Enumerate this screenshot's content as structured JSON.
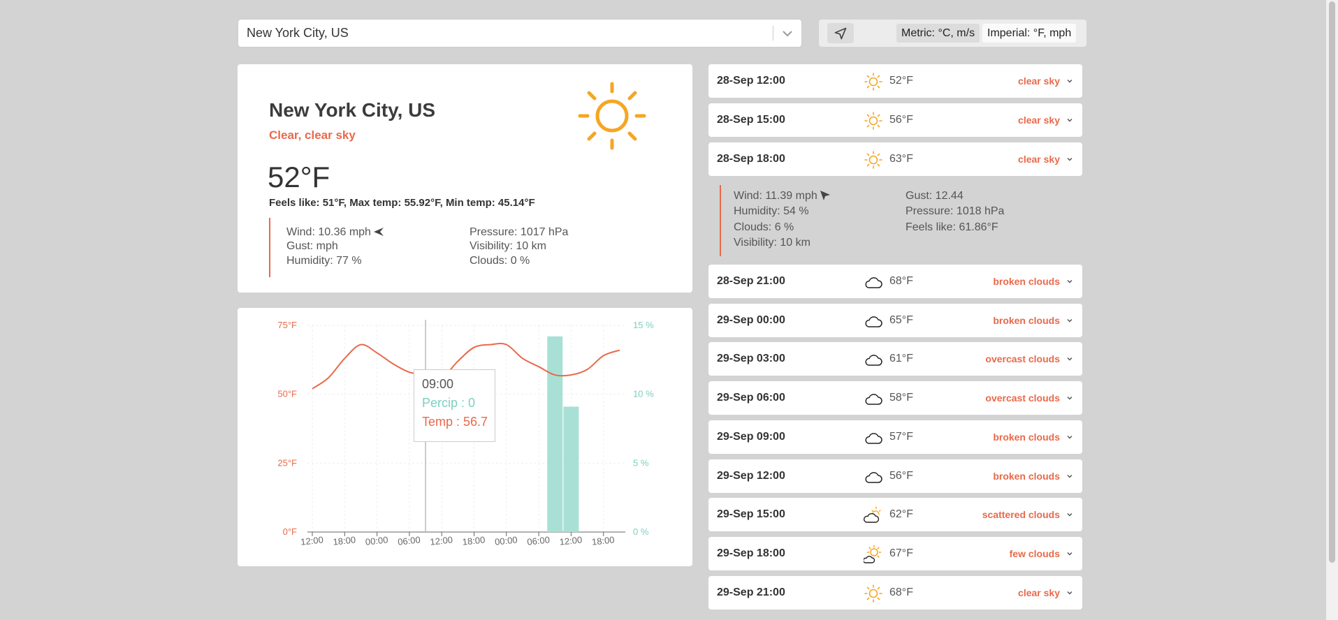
{
  "search": {
    "value": "New York City, US"
  },
  "units": {
    "metric_label": "Metric: °C, m/s",
    "imperial_label": "Imperial: °F, mph",
    "location_icon": "location-arrow-icon"
  },
  "current": {
    "city": "New York City, US",
    "description": "Clear, clear sky",
    "temp": "52°F",
    "feels": "Feels like: 51°F, Max temp: 55.92°F, Min temp: 45.14°F",
    "icon": "sun-icon",
    "wind": "Wind: 10.36 mph",
    "gust": "Gust: mph",
    "humidity": "Humidity: 77 %",
    "pressure": "Pressure: 1017 hPa",
    "visibility": "Visibility: 10 km",
    "clouds": "Clouds: 0 %"
  },
  "chart_data": {
    "type": "line",
    "categories": [
      "12:00",
      "18:00",
      "00:00",
      "06:00",
      "12:00",
      "18:00",
      "00:00",
      "06:00",
      "12:00",
      "18:00"
    ],
    "series": [
      {
        "name": "Temp",
        "axis": "left",
        "color": "#e9694a",
        "x": [
          0,
          0.5,
          1,
          1.5,
          2,
          2.5,
          3,
          3.5,
          4,
          4.5,
          5,
          5.5,
          6,
          6.5,
          7,
          7.5,
          8,
          8.5,
          9,
          9.5
        ],
        "values": [
          52,
          56,
          63,
          68,
          65,
          61,
          58,
          57,
          56,
          62,
          67,
          68,
          68,
          63,
          60,
          57,
          57,
          59,
          64,
          66
        ]
      },
      {
        "name": "Percip",
        "axis": "right",
        "color": "#a8e0d6",
        "x": [
          7.5,
          8
        ],
        "values": [
          14.2,
          9.1
        ]
      }
    ],
    "y_left": {
      "ticks": [
        "0°F",
        "25°F",
        "50°F",
        "75°F"
      ],
      "range": [
        0,
        75
      ]
    },
    "y_right": {
      "ticks": [
        "0 %",
        "5 %",
        "10 %",
        "15 %"
      ],
      "range": [
        0,
        15
      ]
    },
    "tooltip": {
      "time": "09:00",
      "percip": "Percip : 0",
      "temp": "Temp : 56.7"
    },
    "grid": true
  },
  "forecast": [
    {
      "dt": "28-Sep 12:00",
      "temp": "52°F",
      "desc": "clear sky",
      "icon": "sun-icon"
    },
    {
      "dt": "28-Sep 15:00",
      "temp": "56°F",
      "desc": "clear sky",
      "icon": "sun-icon"
    },
    {
      "dt": "28-Sep 18:00",
      "temp": "63°F",
      "desc": "clear sky",
      "icon": "sun-icon"
    },
    {
      "dt": "28-Sep 21:00",
      "temp": "68°F",
      "desc": "broken clouds",
      "icon": "cloud-icon"
    },
    {
      "dt": "29-Sep 00:00",
      "temp": "65°F",
      "desc": "broken clouds",
      "icon": "cloud-icon"
    },
    {
      "dt": "29-Sep 03:00",
      "temp": "61°F",
      "desc": "overcast clouds",
      "icon": "cloud-icon"
    },
    {
      "dt": "29-Sep 06:00",
      "temp": "58°F",
      "desc": "overcast clouds",
      "icon": "cloud-icon"
    },
    {
      "dt": "29-Sep 09:00",
      "temp": "57°F",
      "desc": "broken clouds",
      "icon": "cloud-icon"
    },
    {
      "dt": "29-Sep 12:00",
      "temp": "56°F",
      "desc": "broken clouds",
      "icon": "cloud-icon"
    },
    {
      "dt": "29-Sep 15:00",
      "temp": "62°F",
      "desc": "scattered clouds",
      "icon": "cloud-sun-icon"
    },
    {
      "dt": "29-Sep 18:00",
      "temp": "67°F",
      "desc": "few clouds",
      "icon": "sun-cloud-icon"
    },
    {
      "dt": "29-Sep 21:00",
      "temp": "68°F",
      "desc": "clear sky",
      "icon": "sun-icon"
    }
  ],
  "expanded": {
    "wind": "Wind: 11.39 mph",
    "humidity": "Humidity: 54 %",
    "clouds": "Clouds: 6 %",
    "visibility": "Visibility: 10 km",
    "gust": "Gust: 12.44",
    "pressure": "Pressure: 1018 hPa",
    "feels": "Feels like: 61.86°F"
  },
  "colors": {
    "accent": "#e9694a",
    "sun": "#f5a623",
    "precip": "#a8e0d6",
    "background": "#d3d3d3"
  }
}
